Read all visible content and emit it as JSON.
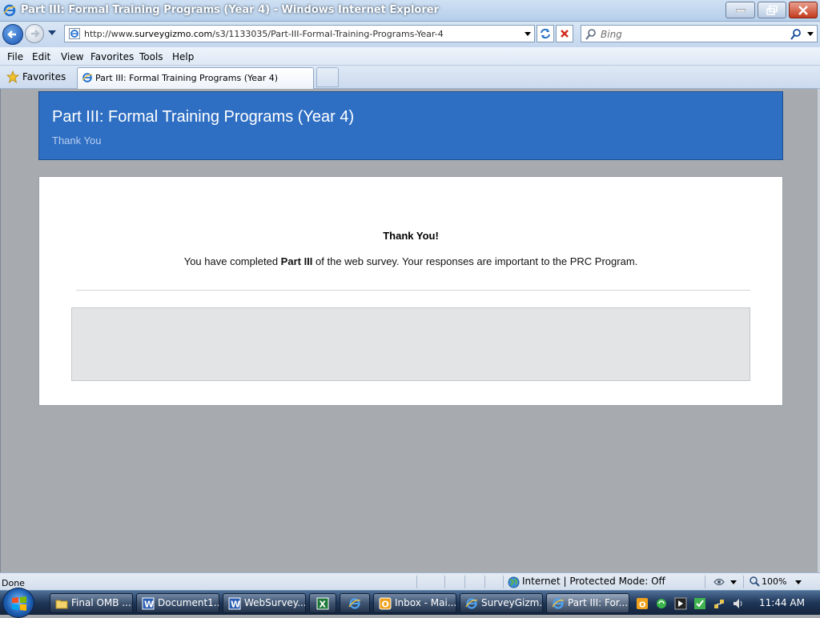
{
  "window": {
    "title": "Part III: Formal Training Programs (Year 4) - Windows Internet Explorer"
  },
  "navigation": {
    "url_prefix": "http://www.",
    "url_domain": "surveygizmo.com",
    "url_path": "/s3/1133035/Part-III-Formal-Training-Programs-Year-4",
    "search_placeholder": "Bing"
  },
  "menu": [
    "File",
    "Edit",
    "View",
    "Favorites",
    "Tools",
    "Help"
  ],
  "favorites": {
    "label": "Favorites"
  },
  "tabs": [
    {
      "label": "Part III: Formal Training Programs (Year 4)"
    }
  ],
  "page": {
    "banner_title": "Part III: Formal Training Programs (Year 4)",
    "banner_subtitle": "Thank You",
    "thanks_heading": "Thank You!",
    "message_before": "You have completed ",
    "message_bold": "Part III",
    "message_after": " of the web survey. Your responses are important to the PRC Program."
  },
  "status": {
    "text": "Done",
    "zone": "Internet | Protected Mode: Off",
    "zoom": "100%"
  },
  "taskbar": {
    "items": [
      {
        "label": "Final OMB ...",
        "icon": "folder-icon"
      },
      {
        "label": "Document1...",
        "icon": "word-icon"
      },
      {
        "label": "WebSurvey...",
        "icon": "word-icon"
      },
      {
        "label": "",
        "icon": "excel-icon"
      },
      {
        "label": "",
        "icon": "ie-icon"
      },
      {
        "label": "Inbox - Mai...",
        "icon": "outlook-icon"
      },
      {
        "label": "SurveyGizm...",
        "icon": "ie-icon"
      },
      {
        "label": "Part III: For...",
        "icon": "ie-icon"
      }
    ],
    "clock": "11:44 AM"
  },
  "colors": {
    "banner": "#2f6fc3",
    "page_bg": "#a7abaf"
  }
}
